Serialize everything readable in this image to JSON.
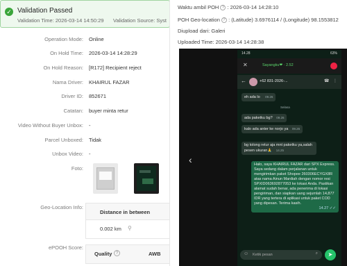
{
  "banner": {
    "title": "Validation Passed",
    "validation_time": "Validation Time: 2026-03-14 14:50:29",
    "validation_source": "Validation Source: Syst"
  },
  "details": {
    "operation_mode": {
      "label": "Operation Mode:",
      "value": "Online"
    },
    "on_hold_time": {
      "label": "On Hold Time:",
      "value": "2026-03-14 14:28:29"
    },
    "on_hold_reason": {
      "label": "On Hold Reason:",
      "value": "[R172] Recipient reject"
    },
    "driver_name": {
      "label": "Nama Driver:",
      "value": "KHAIRUL FAZAR"
    },
    "driver_id": {
      "label": "Driver ID:",
      "value": "852671"
    },
    "notes": {
      "label": "Catatan:",
      "value": "buyer minta retur"
    },
    "video_without_buyer_unbox": {
      "label": "Video Without Buyer Unbox:",
      "value": "-"
    },
    "parcel_unboxed": {
      "label": "Parcel Unboxed:",
      "value": "Tidak"
    },
    "unbox_video": {
      "label": "Unbox Video:",
      "value": "-"
    },
    "photo": {
      "label": "Foto:"
    },
    "geo_location": {
      "label": "Geo-Location Info:"
    },
    "epooh_score": {
      "label": "ePOOH Score:"
    }
  },
  "geo_table": {
    "header": "Distance in between",
    "distance": "0.002 km"
  },
  "quality_table": {
    "quality": "Quality",
    "awb": "AWB"
  },
  "poh": {
    "time_label": "Waktu ambil POH",
    "time_value": ": 2026-03-14 14:28:10",
    "geo_label": "POH Geo-location",
    "geo_value": ": (Latitude) 3.6976114 / (Longitude) 98.1553812",
    "upload_from": "Diupload dari: Galeri",
    "uploaded_time": "Uploaded Time: 2026-03-14 14:28:38"
  },
  "phone": {
    "status_time": "14.28",
    "status_right": "63%",
    "call_name": "Sayangku❤ · 2.52",
    "chat_number": "+62 831-2026-...",
    "msg1": "eh ada lo",
    "msg1_time": "09.26",
    "sys_label": "Selasa",
    "msg2": "ada paketku bg?",
    "msg2_time": "09.26",
    "msg3": "kalo ada anter ke norjo ya",
    "msg3_time": "09.26",
    "msg4": "bg tolong retur aja mnt paketku ya,salah pesen ukuran🙏",
    "msg4_time": "14.25",
    "msg5": "Halo, saya KHAIRUL FAZAR  dari SPX Express. Saya sedang dalam perjalanan untuk mengirimkan paket Shopee 260306ECYGX8R atas nama Ainun Mardiah  dengan nomor resi SPXID063692877053  ke lokasi Anda. Pastikan alamat sudah benar, ada penerima di lokasi pengiriman, dan siapkan uang sejumlah 14,877 IDR  yang tertera di aplikasi untuk paket COD yang dipesan. Terima kasih.",
    "msg5_time": "14.27 ✓✓",
    "input_placeholder": "Ketik pesan"
  }
}
